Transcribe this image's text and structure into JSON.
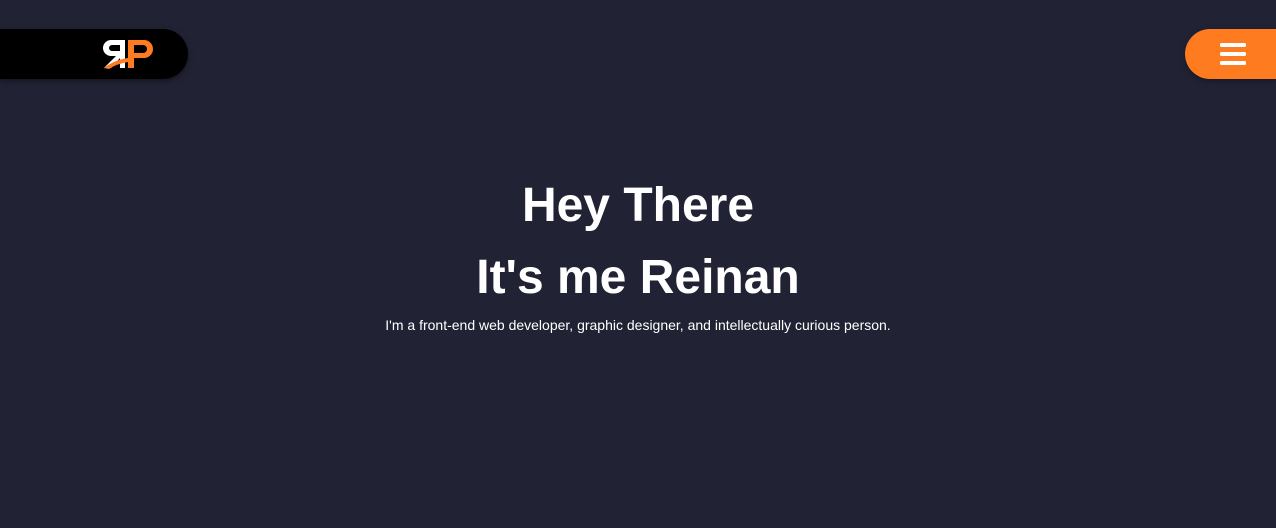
{
  "header": {
    "logo": {
      "icon": "rp-monogram-logo",
      "colors": {
        "primary": "#ffffff",
        "accent": "#fe7b1f"
      }
    },
    "menu_button": {
      "icon": "hamburger-menu-icon",
      "color": "#fe7b1f"
    }
  },
  "hero": {
    "line1": "Hey There",
    "line2": "It's me Reinan",
    "tagline": "I'm a front-end web developer, graphic designer, and intellectually curious person."
  },
  "theme": {
    "background": "#212335",
    "accent": "#fe7b1f",
    "text": "#ffffff"
  }
}
